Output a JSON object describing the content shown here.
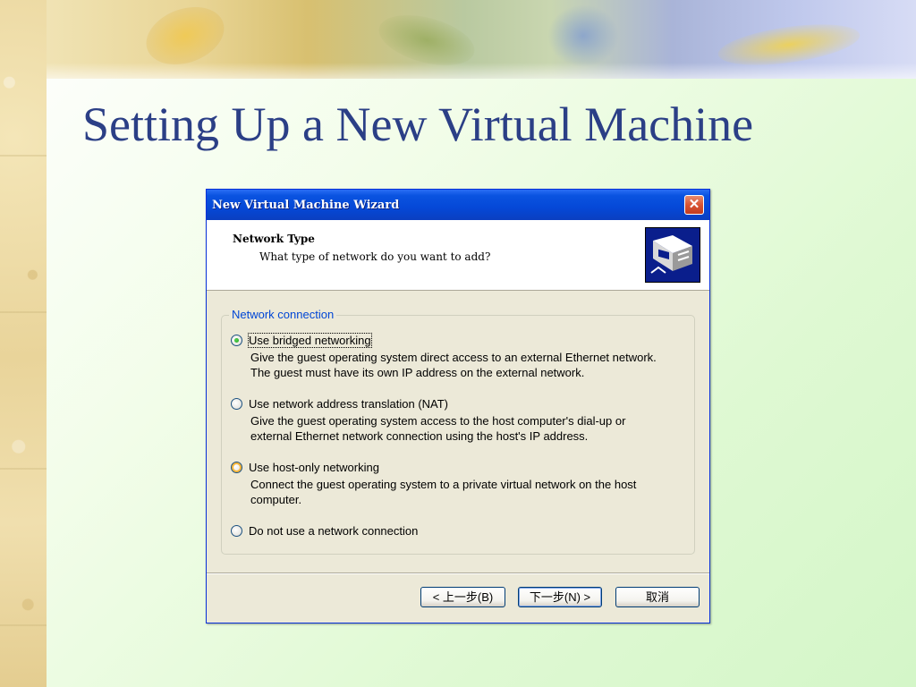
{
  "slide": {
    "title": "Setting Up a New Virtual Machine"
  },
  "dialog": {
    "title": "New Virtual Machine Wizard",
    "close_glyph": "✕",
    "header": {
      "title": "Network Type",
      "subtitle": "What type of network do you want to add?",
      "image_icon": "network-wizard-icon"
    },
    "group_label": "Network connection",
    "options": [
      {
        "label": "Use bridged networking",
        "description_line1": "Give the guest operating system direct access to an external Ethernet network.",
        "description_line2": "The guest must have its own IP address on the external network.",
        "checked": true
      },
      {
        "label": "Use network address translation (NAT)",
        "description_line1": "Give the guest operating system access to the host computer's dial-up or",
        "description_line2": "external Ethernet network connection using the host's IP address.",
        "checked": false
      },
      {
        "label": "Use host-only networking",
        "description_line1": "Connect the guest operating system to a private virtual network on the host",
        "description_line2": "computer.",
        "checked": false
      },
      {
        "label": "Do not use a network connection",
        "checked": false
      }
    ],
    "buttons": {
      "back": "< 上一步(B)",
      "next": "下一步(N) >",
      "cancel": "取消"
    },
    "colors": {
      "titlebar": "#0548d7",
      "face": "#ece9d8",
      "group_label": "#0046d5"
    }
  }
}
